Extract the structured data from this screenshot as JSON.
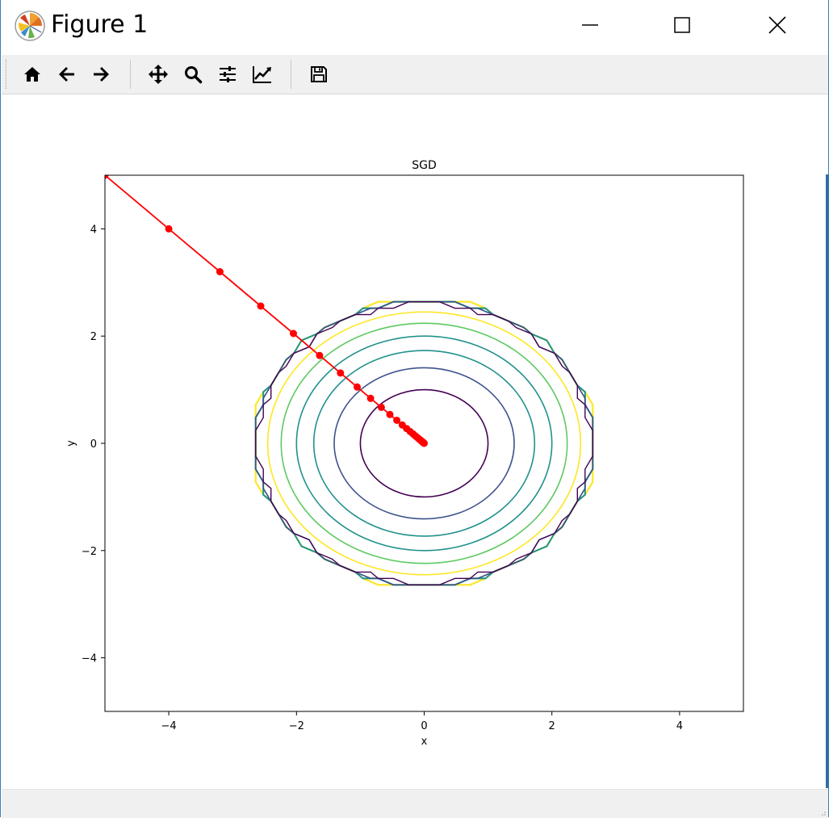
{
  "window": {
    "title": "Figure 1",
    "app_icon": "matplotlib-logo-icon",
    "controls": {
      "minimize_icon": "minimize-icon",
      "maximize_icon": "maximize-icon",
      "close_icon": "close-icon"
    }
  },
  "toolbar": {
    "buttons": [
      {
        "name": "home",
        "icon": "home-icon"
      },
      {
        "name": "back",
        "icon": "arrow-left-icon"
      },
      {
        "name": "forward",
        "icon": "arrow-right-icon"
      },
      {
        "name": "pan",
        "icon": "move-icon"
      },
      {
        "name": "zoom",
        "icon": "search-icon"
      },
      {
        "name": "subplots",
        "icon": "sliders-icon"
      },
      {
        "name": "edit-axes",
        "icon": "line-chart-icon"
      },
      {
        "name": "save",
        "icon": "save-icon"
      }
    ]
  },
  "status": {
    "text": ""
  },
  "colors": {
    "path": "#ff0000",
    "contours": [
      "#440154",
      "#3b528b",
      "#21918c",
      "#21918c",
      "#5ec962",
      "#fde725"
    ],
    "outer_band": [
      "#fde725",
      "#5ec962",
      "#21918c",
      "#3b528b",
      "#440154"
    ]
  },
  "chart_data": {
    "type": "line",
    "title": "SGD",
    "xlabel": "x",
    "ylabel": "y",
    "xlim": [
      -5,
      5
    ],
    "ylim": [
      -5,
      5
    ],
    "xticks": [
      -4,
      -2,
      0,
      2,
      4
    ],
    "yticks": [
      -4,
      -2,
      0,
      2,
      4
    ],
    "xtick_labels": [
      "−4",
      "−2",
      "0",
      "2",
      "4"
    ],
    "ytick_labels": [
      "−4",
      "−2",
      "0",
      "2",
      "4"
    ],
    "grid": false,
    "contour_levels_radius_x": [
      1.0,
      1.41,
      1.73,
      2.0,
      2.24,
      2.45
    ],
    "contour_levels_radius_y": [
      1.0,
      1.41,
      1.73,
      2.0,
      2.24,
      2.45
    ],
    "path": {
      "x": [
        -5.0,
        -4.0,
        -3.2,
        -2.56,
        -2.048,
        -1.638,
        -1.311,
        -1.049,
        -0.839,
        -0.671,
        -0.537,
        -0.429,
        -0.344,
        -0.275,
        -0.22,
        -0.176,
        -0.141,
        -0.113,
        -0.09,
        -0.072,
        -0.058,
        -0.046,
        -0.037,
        -0.03,
        -0.024,
        -0.019,
        -0.015,
        -0.012,
        -0.01,
        -0.008,
        0.0
      ],
      "y": [
        5.0,
        4.0,
        3.2,
        2.56,
        2.048,
        1.638,
        1.311,
        1.049,
        0.839,
        0.671,
        0.537,
        0.429,
        0.344,
        0.275,
        0.22,
        0.176,
        0.141,
        0.113,
        0.09,
        0.072,
        0.058,
        0.046,
        0.037,
        0.03,
        0.024,
        0.019,
        0.015,
        0.012,
        0.01,
        0.008,
        0.0
      ]
    }
  }
}
